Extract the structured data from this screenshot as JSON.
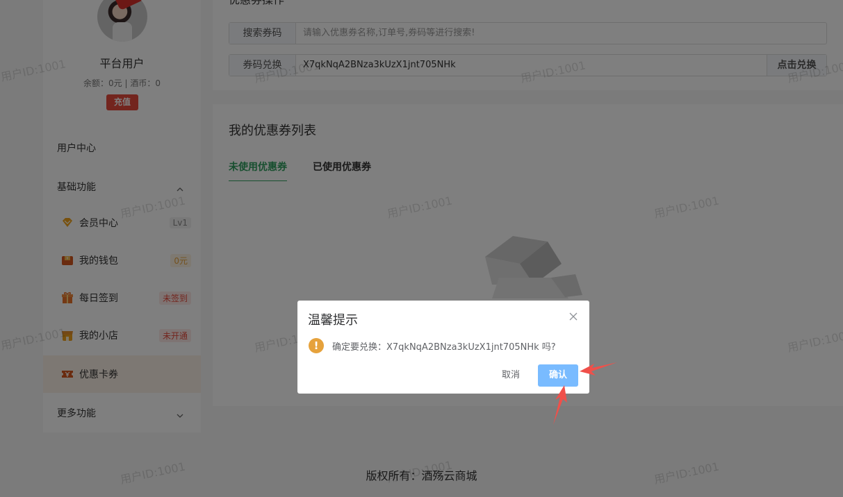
{
  "sidebar": {
    "user_name": "平台用户",
    "balance_text": "余额：0元 | 酒币：0",
    "recharge_label": "充值",
    "user_center": "用户中心",
    "basic_functions": "基础功能",
    "more_functions": "更多功能",
    "items": [
      {
        "label": "会员中心",
        "badge": "Lv1",
        "icon": "diamond-icon",
        "badge_color": "#888888",
        "badge_bg": "#f0f0f0"
      },
      {
        "label": "我的钱包",
        "badge": "0元",
        "icon": "wallet-icon",
        "badge_color": "#e6a23c",
        "badge_bg": "#fdf3e2"
      },
      {
        "label": "每日签到",
        "badge": "未签到",
        "icon": "gift-icon",
        "badge_color": "#e64b3c",
        "badge_bg": "#fde9e6"
      },
      {
        "label": "我的小店",
        "badge": "未开通",
        "icon": "shop-icon",
        "badge_color": "#e64b3c",
        "badge_bg": "#fde9e6"
      },
      {
        "label": "优惠卡券",
        "badge": "",
        "icon": "coupon-icon",
        "active": true
      }
    ]
  },
  "coupon_ops": {
    "title": "优惠券操作",
    "search_label": "搜索券码",
    "search_placeholder": "请输入优惠券名称,订单号,券码等进行搜索!",
    "redeem_label": "券码兑换",
    "redeem_value": "X7qkNqA2BNza3kUzX1jnt705NHk",
    "redeem_button": "点击兑换"
  },
  "coupon_list": {
    "title": "我的优惠券列表",
    "tabs": [
      {
        "label": "未使用优惠券",
        "active": true
      },
      {
        "label": "已使用优惠券",
        "active": false
      }
    ]
  },
  "footer": {
    "copyright": "版权所有：酒殇云商城"
  },
  "watermark": "用户ID:1001",
  "dialog": {
    "title": "温馨提示",
    "message": "确定要兑换：X7qkNqA2BNza3kUzX1jnt705NHk 吗?",
    "cancel": "取消",
    "confirm": "确认",
    "warning_icon": "!"
  },
  "colors": {
    "accent_green": "#2f9e5e",
    "recharge_red": "#e64b3c",
    "confirm_blue": "#79bbff",
    "warning_orange": "#e6a23c",
    "arrow_red": "#f0504a"
  }
}
